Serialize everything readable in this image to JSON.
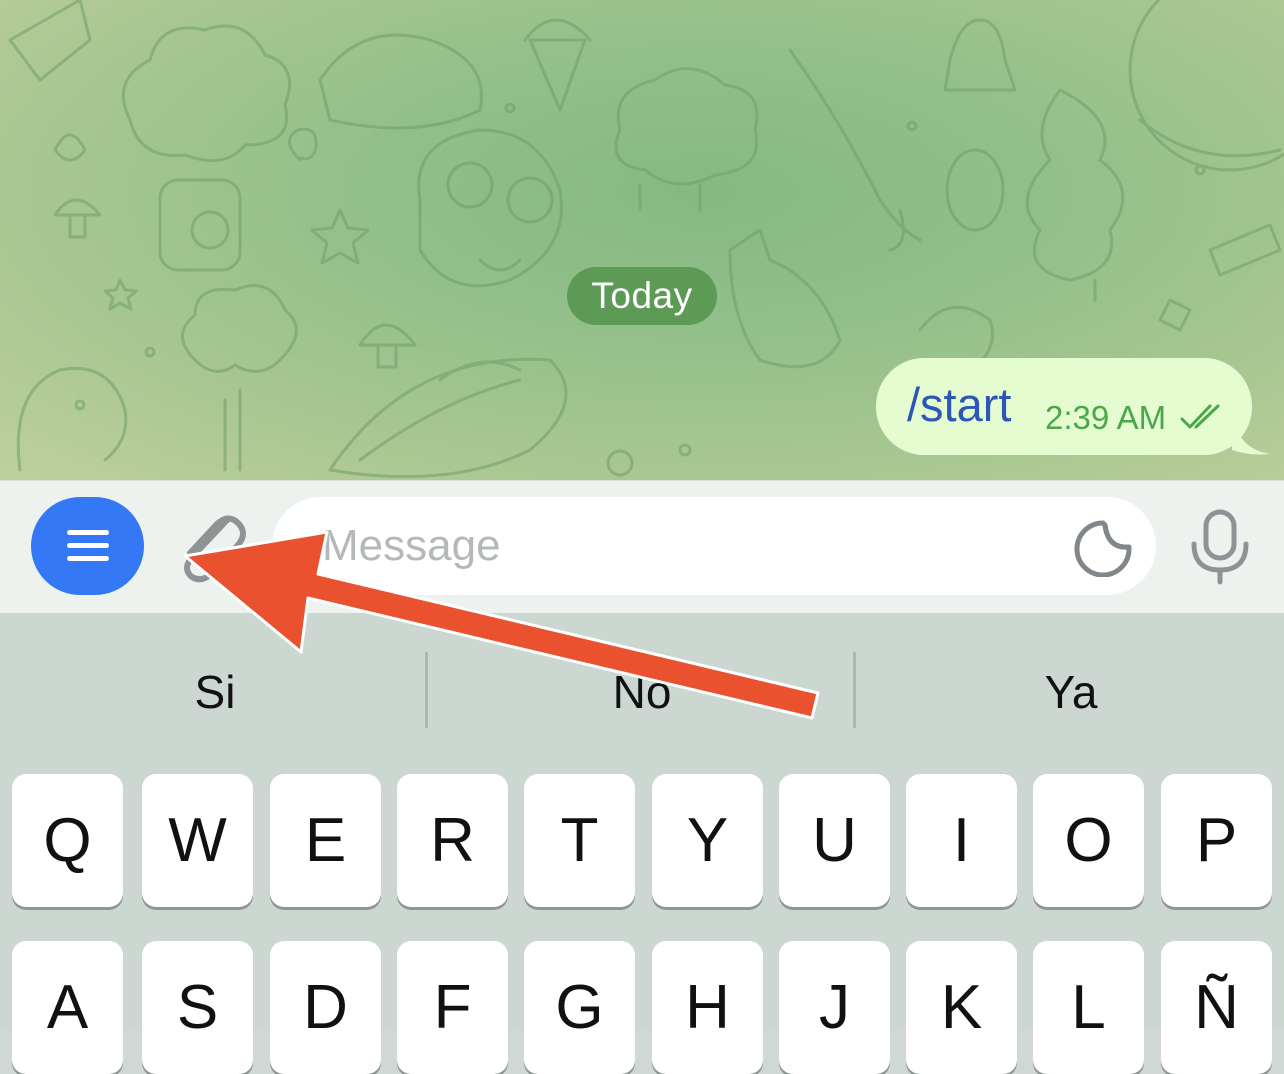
{
  "chat": {
    "date_label": "Today",
    "message": {
      "text": "/start",
      "time": "2:39 AM",
      "status_icon": "double-check-icon"
    }
  },
  "input_bar": {
    "menu_icon": "menu-icon",
    "attach_icon": "paperclip-icon",
    "placeholder": "Message",
    "sticker_icon": "sticker-icon",
    "mic_icon": "microphone-icon"
  },
  "keyboard": {
    "suggestions": [
      "Si",
      "No",
      "Ya"
    ],
    "row1": [
      "Q",
      "W",
      "E",
      "R",
      "T",
      "Y",
      "U",
      "I",
      "O",
      "P"
    ],
    "row2": [
      "A",
      "S",
      "D",
      "F",
      "G",
      "H",
      "J",
      "K",
      "L",
      "Ñ"
    ]
  },
  "annotation": {
    "arrow_color": "#e9512f",
    "points_to": "attach-icon"
  },
  "colors": {
    "menu_button": "#3478f6",
    "date_pill": "#5d9a56",
    "bubble": "#e5fbd0",
    "message_text": "#2c56b8",
    "time_text": "#4aa84a"
  }
}
